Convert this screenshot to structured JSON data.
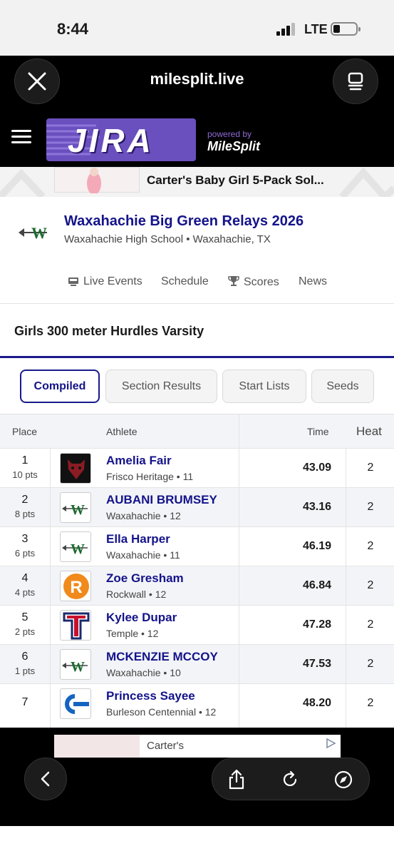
{
  "status": {
    "time": "8:44",
    "network": "LTE"
  },
  "browser": {
    "url": "milesplit.live",
    "close_icon": "close-icon",
    "tabs_icon": "tabs-icon"
  },
  "site": {
    "logo_text": "JIRA",
    "powered_by": "powered by",
    "brand": "MileSplit"
  },
  "ad_top": {
    "text": "Carter's Baby Girl 5-Pack Sol..."
  },
  "meet": {
    "title": "Waxahachie Big Green Relays 2026",
    "subtitle": "Waxahachie High School • Waxahachie, TX",
    "nav": [
      {
        "label": "Live Events",
        "icon": "live-events-icon"
      },
      {
        "label": "Schedule"
      },
      {
        "label": "Scores",
        "icon": "trophy-icon"
      },
      {
        "label": "News"
      }
    ]
  },
  "event": {
    "title": "Girls 300 meter Hurdles Varsity"
  },
  "tabs": [
    "Compiled",
    "Section Results",
    "Start Lists",
    "Seeds"
  ],
  "table": {
    "headers": {
      "place": "Place",
      "athlete": "Athlete",
      "time": "Time",
      "heat": "Heat"
    },
    "rows": [
      {
        "place": "1",
        "pts": "10 pts",
        "name": "Amelia Fair",
        "school": "Frisco Heritage • 11",
        "time": "43.09",
        "heat": "2",
        "logo": "frisco-heritage"
      },
      {
        "place": "2",
        "pts": "8 pts",
        "name": "AUBANI BRUMSEY",
        "school": "Waxahachie • 12",
        "time": "43.16",
        "heat": "2",
        "logo": "waxahachie"
      },
      {
        "place": "3",
        "pts": "6 pts",
        "name": "Ella Harper",
        "school": "Waxahachie • 11",
        "time": "46.19",
        "heat": "2",
        "logo": "waxahachie"
      },
      {
        "place": "4",
        "pts": "4 pts",
        "name": "Zoe Gresham",
        "school": "Rockwall • 12",
        "time": "46.84",
        "heat": "2",
        "logo": "rockwall"
      },
      {
        "place": "5",
        "pts": "2 pts",
        "name": "Kylee Dupar",
        "school": "Temple • 12",
        "time": "47.28",
        "heat": "2",
        "logo": "temple"
      },
      {
        "place": "6",
        "pts": "1 pts",
        "name": "MCKENZIE MCCOY",
        "school": "Waxahachie • 10",
        "time": "47.53",
        "heat": "2",
        "logo": "waxahachie"
      },
      {
        "place": "7",
        "pts": "",
        "name": "Princess Sayee",
        "school": "Burleson Centennial • 12",
        "time": "48.20",
        "heat": "2",
        "logo": "burleson-centennial"
      }
    ]
  },
  "ad_bottom": {
    "text": "Carter's"
  },
  "colors": {
    "accent": "#14138a",
    "brand_purple": "#6a4fbf",
    "row_alt": "#f2f4f7"
  }
}
